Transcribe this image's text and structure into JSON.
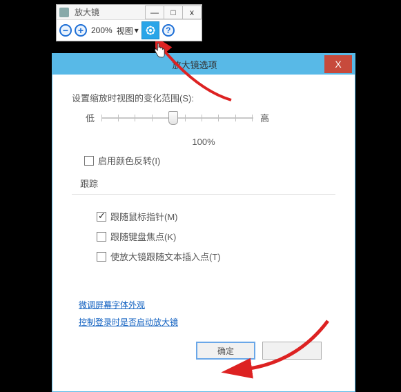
{
  "toolbar": {
    "title": "放大镜",
    "zoom_percent": "200%",
    "view_label": "视图",
    "minimize": "—",
    "maximize": "□",
    "close": "x",
    "help": "?",
    "minus": "−",
    "plus": "+",
    "dropdown_arrow": "▾"
  },
  "dialog": {
    "title": "放大镜选项",
    "close": "X",
    "slider_heading": "设置缩放时视图的变化范围(S):",
    "low": "低",
    "high": "高",
    "percent": "100%",
    "invert": "启用颜色反转(I)",
    "track_group": "跟踪",
    "track_mouse": "跟随鼠标指针(M)",
    "track_keyboard": "跟随键盘焦点(K)",
    "track_caret": "使放大镜跟随文本插入点(T)",
    "link_font": "微调屏幕字体外观",
    "link_logon": "控制登录时是否启动放大镜",
    "ok": "确定",
    "cancel": ""
  }
}
